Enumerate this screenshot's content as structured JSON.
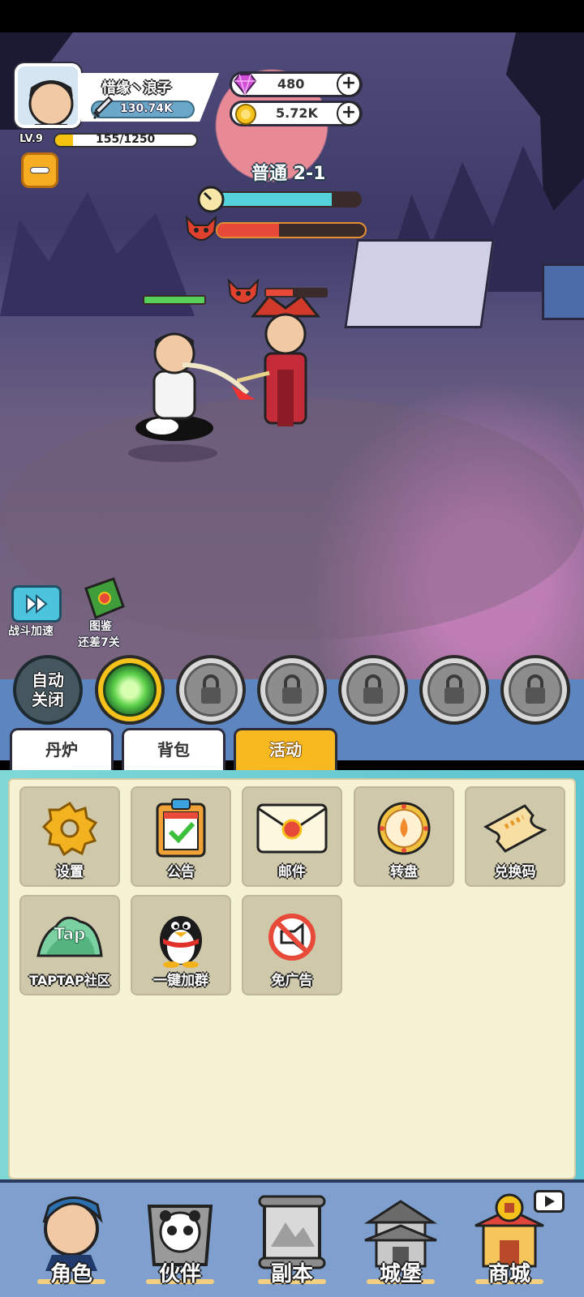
{
  "player": {
    "name": "惜缘丶浪子",
    "power": "130.74K",
    "level": "LV.9",
    "exp_text": "155/1250",
    "exp_fraction": 0.124
  },
  "resources": {
    "gems": "480",
    "coins": "5.72K"
  },
  "stage": {
    "label": "普通 2-1",
    "timer_fraction": 0.8,
    "boss_hp_fraction": 0.42
  },
  "battle": {
    "player_hp_fraction": 1.0,
    "enemy_hp_fraction": 0.45
  },
  "side_buttons": {
    "speed_label": "战斗加速",
    "codex_label": "图鉴",
    "codex_sub": "还差7关"
  },
  "skills": {
    "auto_label_1": "自动",
    "auto_label_2": "关闭"
  },
  "tabs": [
    {
      "label": "丹炉"
    },
    {
      "label": "背包"
    },
    {
      "label": "活动"
    }
  ],
  "activities": [
    {
      "label": "设置",
      "icon": "gear-icon"
    },
    {
      "label": "公告",
      "icon": "clipboard-check-icon"
    },
    {
      "label": "邮件",
      "icon": "envelope-icon"
    },
    {
      "label": "转盘",
      "icon": "wheel-icon"
    },
    {
      "label": "兑换码",
      "icon": "ticket-icon"
    },
    {
      "label": "TAPTAP社区",
      "icon": "taptap-icon",
      "icon_text": "Tap"
    },
    {
      "label": "一键加群",
      "icon": "penguin-icon"
    },
    {
      "label": "免广告",
      "icon": "no-ads-icon"
    }
  ],
  "nav": [
    {
      "label": "角色"
    },
    {
      "label": "伙伴"
    },
    {
      "label": "副本"
    },
    {
      "label": "城堡"
    },
    {
      "label": "商城"
    }
  ],
  "colors": {
    "active_tab": "#f8b920",
    "panel_bg": "#f5f3d3",
    "timer_bar": "#56d2dc",
    "hp_red": "#e84a3a",
    "hp_green": "#57d05a"
  }
}
